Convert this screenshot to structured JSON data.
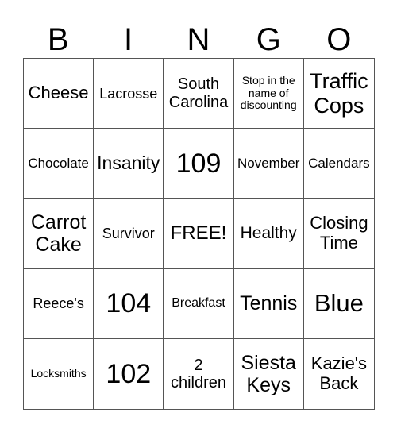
{
  "header": {
    "letters": [
      "B",
      "I",
      "N",
      "G",
      "O"
    ]
  },
  "cells": [
    {
      "text": "Cheese",
      "size": 22
    },
    {
      "text": "Lacrosse",
      "size": 18
    },
    {
      "text": "South Carolina",
      "size": 20
    },
    {
      "text": "Stop in the name of discounting",
      "size": 14
    },
    {
      "text": "Traffic Cops",
      "size": 27
    },
    {
      "text": "Chocolate",
      "size": 17
    },
    {
      "text": "Insanity",
      "size": 23
    },
    {
      "text": "109",
      "size": 34
    },
    {
      "text": "November",
      "size": 17
    },
    {
      "text": "Calendars",
      "size": 17
    },
    {
      "text": "Carrot Cake",
      "size": 25
    },
    {
      "text": "Survivor",
      "size": 18
    },
    {
      "text": "FREE!",
      "size": 24
    },
    {
      "text": "Healthy",
      "size": 21
    },
    {
      "text": "Closing Time",
      "size": 22
    },
    {
      "text": "Reece's",
      "size": 18
    },
    {
      "text": "104",
      "size": 34
    },
    {
      "text": "Breakfast",
      "size": 16
    },
    {
      "text": "Tennis",
      "size": 25
    },
    {
      "text": "Blue",
      "size": 31
    },
    {
      "text": "Locksmiths",
      "size": 14
    },
    {
      "text": "102",
      "size": 34
    },
    {
      "text": "2 children",
      "size": 20
    },
    {
      "text": "Siesta Keys",
      "size": 25
    },
    {
      "text": "Kazie's Back",
      "size": 22
    }
  ]
}
